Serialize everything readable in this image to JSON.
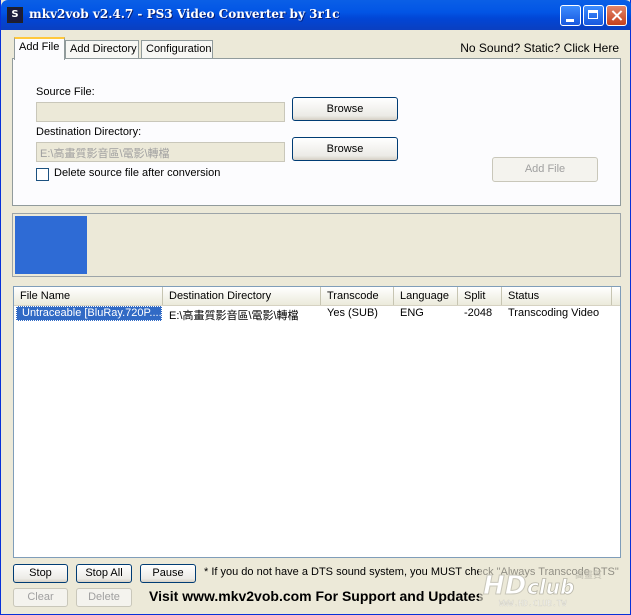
{
  "window": {
    "title": "mkv2vob v2.4.7 - PS3 Video Converter by 3r1c"
  },
  "tabs": [
    {
      "label": "Add File",
      "active": true
    },
    {
      "label": "Add Directory",
      "active": false
    },
    {
      "label": "Configuration",
      "active": false
    }
  ],
  "no_sound_link": "No Sound? Static? Click Here",
  "add_file_panel": {
    "source_label": "Source File:",
    "source_value": "",
    "source_browse": "Browse",
    "dest_label": "Destination Directory:",
    "dest_value": "E:\\高畫質影音區\\電影\\轉檔",
    "dest_browse": "Browse",
    "delete_checkbox_label": "Delete source file after conversion",
    "delete_checked": false,
    "add_file_button": "Add File"
  },
  "progress": {
    "fraction": 0.12
  },
  "queue": {
    "columns": [
      "File Name",
      "Destination Directory",
      "Transcode",
      "Language",
      "Split",
      "Status"
    ],
    "rows": [
      [
        "Untraceable [BluRay.720P....",
        "E:\\高畫質影音區\\電影\\轉檔",
        "Yes (SUB)",
        "ENG",
        "-2048",
        "Transcoding Video"
      ]
    ]
  },
  "bottom": {
    "stop": "Stop",
    "stop_all": "Stop All",
    "pause": "Pause",
    "clear": "Clear",
    "delete": "Delete",
    "note": "* If you do not have a DTS sound system, you MUST check \"Always Transcode DTS\"",
    "visit": "Visit www.mkv2vob.com For Support and Updates"
  },
  "watermark": {
    "logo_text": "HDclub",
    "url": "WWW.HD.CLUB.TW",
    "chinese": "高畫質俱樂部"
  },
  "colors": {
    "titlebar": "#0255e5",
    "progress": "#2e6bd5",
    "selection": "#316ac5",
    "tab_highlight": "#ffc83c"
  }
}
